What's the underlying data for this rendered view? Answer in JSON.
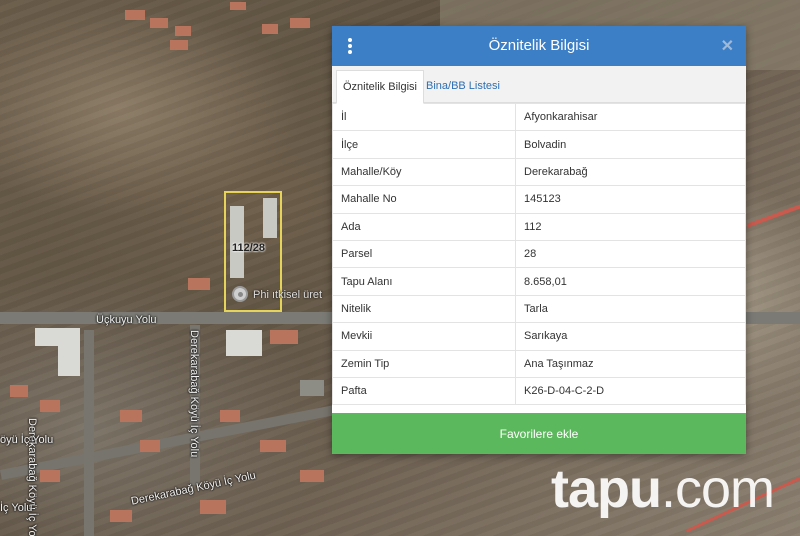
{
  "map": {
    "parcel_label": "112/28",
    "marker_label": "Phi ıtkisel üret",
    "roads": [
      "Üçkuyu Yolu",
      "Derekarabağ Köyü İç Yolu",
      "Derekarabağ Köyü İç Yolu",
      "Derekarabağ Köyü İç Yolu",
      "öyü İç Yolu",
      "İç Yolu"
    ],
    "watermark": {
      "brand": "tapu",
      "suffix": ".com"
    }
  },
  "popup": {
    "title": "Öznitelik Bilgisi",
    "icons": {
      "menu": "kebab-menu-icon",
      "close": "close-icon"
    },
    "tabs": [
      {
        "label": "Öznitelik Bilgisi",
        "active": true
      },
      {
        "label": "Bina/BB Listesi",
        "active": false
      }
    ],
    "rows": [
      {
        "key": "İl",
        "value": "Afyonkarahisar"
      },
      {
        "key": "İlçe",
        "value": "Bolvadin"
      },
      {
        "key": "Mahalle/Köy",
        "value": "Derekarabağ"
      },
      {
        "key": "Mahalle No",
        "value": "145123"
      },
      {
        "key": "Ada",
        "value": "112"
      },
      {
        "key": "Parsel",
        "value": "28"
      },
      {
        "key": "Tapu Alanı",
        "value": "8.658,01"
      },
      {
        "key": "Nitelik",
        "value": "Tarla"
      },
      {
        "key": "Mevkii",
        "value": "Sarıkaya"
      },
      {
        "key": "Zemin Tip",
        "value": "Ana Taşınmaz"
      },
      {
        "key": "Pafta",
        "value": "K26-D-04-C-2-D"
      }
    ],
    "favorite_button": "Favorilere ekle"
  },
  "colors": {
    "header": "#3c7fc6",
    "button": "#5cb85c",
    "parcel_outline": "#e6d35a"
  }
}
